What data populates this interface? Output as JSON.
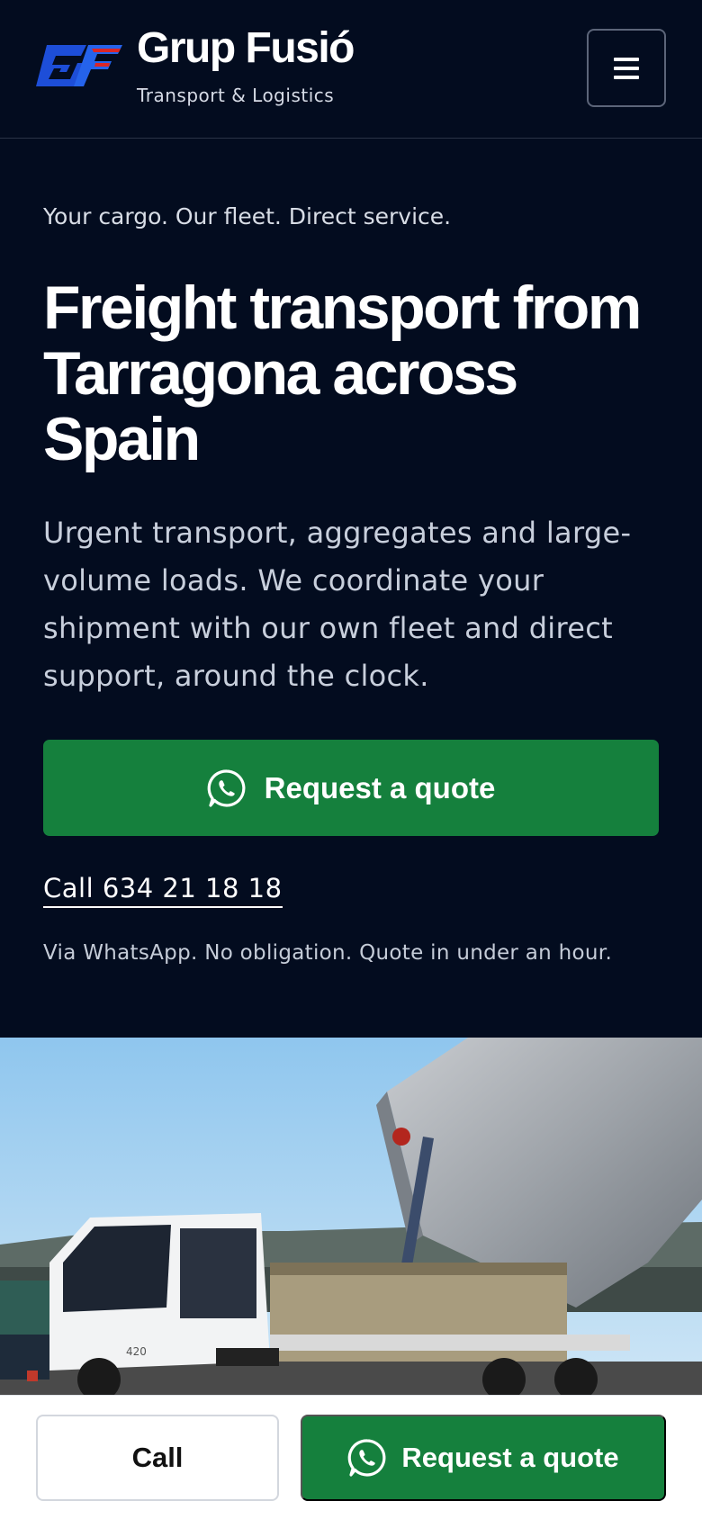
{
  "header": {
    "brand_name": "Grup Fusió",
    "brand_sub": "Transport & Logistics",
    "logo_text": "GF",
    "menu_icon": "hamburger-menu-icon"
  },
  "hero": {
    "eyebrow": "Your cargo. Our fleet. Direct service.",
    "title": "Freight transport from Tarragona across Spain",
    "text": "Urgent transport, aggregates and large-volume loads. We coordinate your shipment with our own fleet and direct support, around the clock.",
    "quote_button": "Request a quote",
    "quote_icon": "whatsapp-icon",
    "call_link": "Call 634 21 18 18",
    "note": "Via WhatsApp. No obligation. Quote in under an hour."
  },
  "photo": {
    "subject": "dump truck photo",
    "cab_model": "420"
  },
  "bottom_bar": {
    "call_button": "Call",
    "quote_button": "Request a quote",
    "quote_icon": "whatsapp-icon"
  },
  "colors": {
    "background": "#030c1f",
    "accent_green": "#15803d",
    "logo_blue": "#1d4ed8",
    "logo_red": "#dc2626"
  }
}
